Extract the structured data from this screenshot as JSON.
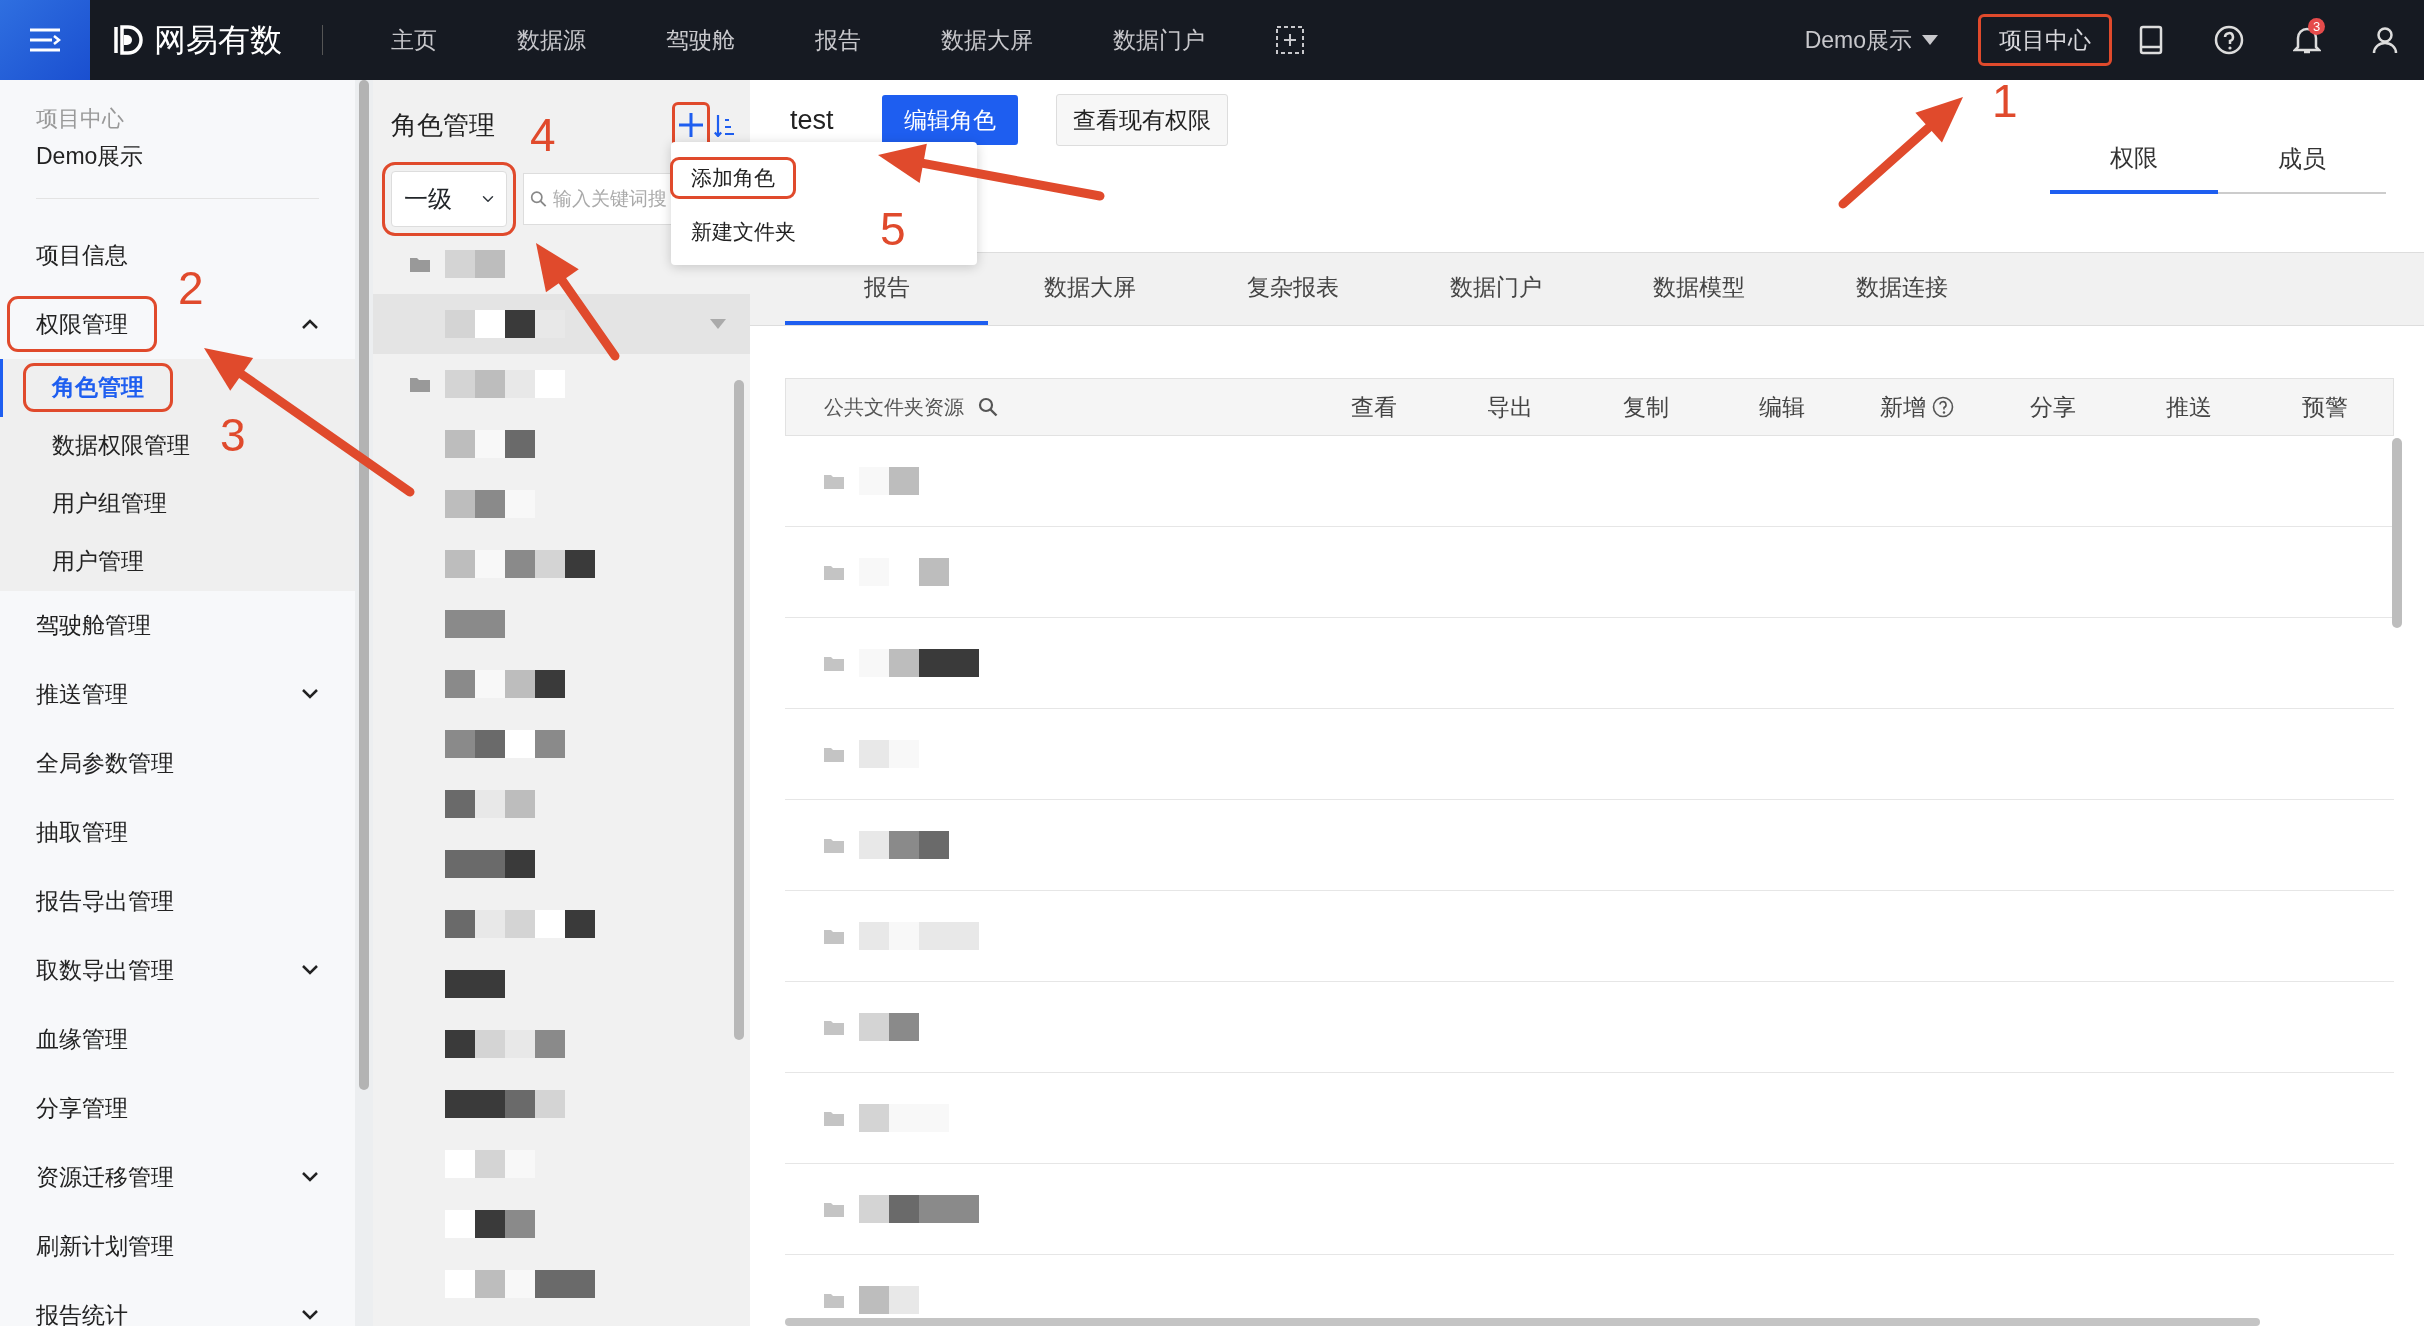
{
  "topbar": {
    "brand": "网易有数",
    "nav": [
      {
        "label": "主页"
      },
      {
        "label": "数据源"
      },
      {
        "label": "驾驶舱"
      },
      {
        "label": "报告"
      },
      {
        "label": "数据大屏"
      },
      {
        "label": "数据门户"
      }
    ],
    "project_select": "Demo展示",
    "project_center": {
      "label": "项目中心",
      "highlighted": true
    },
    "notification_count": "3"
  },
  "sidebar": {
    "caption": "项目中心",
    "project": "Demo展示",
    "items": [
      {
        "label": "项目信息",
        "highlighted": false
      },
      {
        "label": "权限管理",
        "expanded": true,
        "highlighted": true,
        "children": [
          {
            "label": "角色管理",
            "selected": true,
            "highlighted": true
          },
          {
            "label": "数据权限管理",
            "selected": false,
            "highlighted": false
          },
          {
            "label": "用户组管理",
            "selected": false,
            "highlighted": false
          },
          {
            "label": "用户管理",
            "selected": false,
            "highlighted": false
          }
        ]
      },
      {
        "label": "驾驶舱管理",
        "highlighted": false
      },
      {
        "label": "推送管理",
        "expanded": false,
        "highlighted": false
      },
      {
        "label": "全局参数管理",
        "highlighted": false
      },
      {
        "label": "抽取管理",
        "highlighted": false
      },
      {
        "label": "报告导出管理",
        "highlighted": false
      },
      {
        "label": "取数导出管理",
        "expanded": false,
        "highlighted": false
      },
      {
        "label": "血缘管理",
        "highlighted": false
      },
      {
        "label": "分享管理",
        "highlighted": false
      },
      {
        "label": "资源迁移管理",
        "expanded": false,
        "highlighted": false
      },
      {
        "label": "刷新计划管理",
        "highlighted": false
      },
      {
        "label": "报告统计",
        "expanded": false,
        "highlighted": false
      }
    ]
  },
  "role_panel": {
    "title": "角色管理",
    "add_highlighted": true,
    "level_select": {
      "value": "一级",
      "highlighted": true
    },
    "search": {
      "placeholder": "输入关键词搜"
    },
    "add_menu": [
      {
        "label": "添加角色",
        "highlighted": true
      },
      {
        "label": "新建文件夹",
        "highlighted": false
      }
    ],
    "rows": [
      {
        "kind": "folder",
        "selected": false
      },
      {
        "kind": "role",
        "selected": true
      },
      {
        "kind": "folder",
        "selected": false
      },
      {
        "kind": "role",
        "selected": false
      },
      {
        "kind": "role",
        "selected": false
      },
      {
        "kind": "role",
        "selected": false
      },
      {
        "kind": "role",
        "selected": false
      },
      {
        "kind": "role",
        "selected": false
      },
      {
        "kind": "role",
        "selected": false
      },
      {
        "kind": "role",
        "selected": false
      },
      {
        "kind": "role",
        "selected": false
      },
      {
        "kind": "role",
        "selected": false
      },
      {
        "kind": "role",
        "selected": false
      },
      {
        "kind": "role",
        "selected": false
      },
      {
        "kind": "role",
        "selected": false
      },
      {
        "kind": "role",
        "selected": false
      },
      {
        "kind": "role",
        "selected": false
      },
      {
        "kind": "role",
        "selected": false
      }
    ]
  },
  "detail": {
    "role_name": "test",
    "buttons": [
      {
        "label": "编辑角色",
        "kind": "primary"
      },
      {
        "label": "查看现有权限",
        "kind": "secondary"
      }
    ],
    "tabs": [
      {
        "label": "权限",
        "selected": true
      },
      {
        "label": "成员",
        "selected": false
      }
    ],
    "resource_tabs": [
      {
        "label": "报告",
        "selected": true
      },
      {
        "label": "数据大屏",
        "selected": false
      },
      {
        "label": "复杂报表",
        "selected": false
      },
      {
        "label": "数据门户",
        "selected": false
      },
      {
        "label": "数据模型",
        "selected": false
      },
      {
        "label": "数据连接",
        "selected": false
      }
    ],
    "table": {
      "columns": [
        {
          "label": "公共文件夹资源",
          "kind": "search"
        },
        {
          "label": "查看"
        },
        {
          "label": "导出"
        },
        {
          "label": "复制"
        },
        {
          "label": "编辑"
        },
        {
          "label": "新增",
          "kind": "help"
        },
        {
          "label": "分享"
        },
        {
          "label": "推送"
        },
        {
          "label": "预警"
        }
      ],
      "rows": [
        {
          "kind": "folder"
        },
        {
          "kind": "folder"
        },
        {
          "kind": "folder"
        },
        {
          "kind": "folder"
        },
        {
          "kind": "folder"
        },
        {
          "kind": "folder"
        },
        {
          "kind": "folder"
        },
        {
          "kind": "folder"
        },
        {
          "kind": "folder"
        },
        {
          "kind": "folder"
        }
      ]
    }
  },
  "annotations": [
    {
      "label": "1"
    },
    {
      "label": "2"
    },
    {
      "label": "3"
    },
    {
      "label": "4"
    },
    {
      "label": "5"
    }
  ]
}
